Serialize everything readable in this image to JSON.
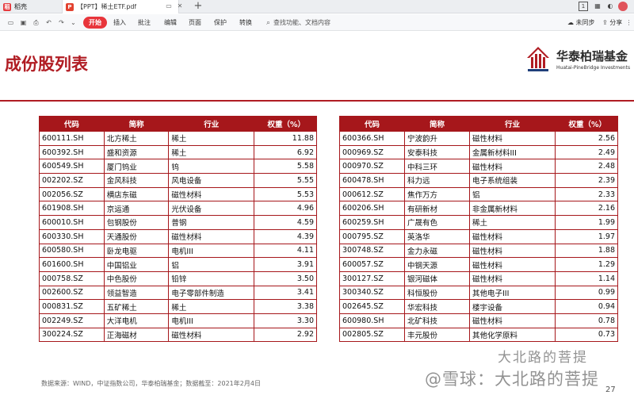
{
  "tabs": {
    "home_label": "稻壳",
    "doc_label": "【PPT】稀土ETF.pdf",
    "doc_logo": "P"
  },
  "toolbar": {
    "menus": [
      "开始",
      "插入",
      "批注",
      "编辑",
      "页面",
      "保护",
      "转换"
    ],
    "search_placeholder": "查找功能、文档内容",
    "unsync": "未同步",
    "share": "分享",
    "window_badge": "1"
  },
  "slide": {
    "title": "成份股列表",
    "logo_cn": "华泰柏瑞基金",
    "logo_en": "Huatai-PineBridge Investments",
    "source": "数据来源：WIND，中证指数公司，华泰柏瑞基金；数据截至：2021年2月4日",
    "page_number": "27",
    "watermark_line1": "大北路的菩提",
    "watermark_line2": "@雪球：大北路的菩提"
  },
  "table_headers": [
    "代码",
    "简称",
    "行业",
    "权重（%）"
  ],
  "left_table": [
    [
      "600111.SH",
      "北方稀土",
      "稀土",
      "11.88"
    ],
    [
      "600392.SH",
      "盛和资源",
      "稀土",
      "6.92"
    ],
    [
      "600549.SH",
      "厦门钨业",
      "钨",
      "5.58"
    ],
    [
      "002202.SZ",
      "金风科技",
      "风电设备",
      "5.55"
    ],
    [
      "002056.SZ",
      "横店东磁",
      "磁性材料",
      "5.53"
    ],
    [
      "601908.SH",
      "京运通",
      "光伏设备",
      "4.96"
    ],
    [
      "600010.SH",
      "包钢股份",
      "普钢",
      "4.59"
    ],
    [
      "600330.SH",
      "天通股份",
      "磁性材料",
      "4.39"
    ],
    [
      "600580.SH",
      "卧龙电驱",
      "电机III",
      "4.11"
    ],
    [
      "601600.SH",
      "中国铝业",
      "铝",
      "3.91"
    ],
    [
      "000758.SZ",
      "中色股份",
      "铅锌",
      "3.50"
    ],
    [
      "002600.SZ",
      "领益智造",
      "电子零部件制造",
      "3.41"
    ],
    [
      "000831.SZ",
      "五矿稀土",
      "稀土",
      "3.38"
    ],
    [
      "002249.SZ",
      "大洋电机",
      "电机III",
      "3.30"
    ],
    [
      "300224.SZ",
      "正海磁材",
      "磁性材料",
      "2.92"
    ]
  ],
  "right_table": [
    [
      "600366.SH",
      "宁波韵升",
      "磁性材料",
      "2.56"
    ],
    [
      "000969.SZ",
      "安泰科技",
      "金属新材料III",
      "2.49"
    ],
    [
      "000970.SZ",
      "中科三环",
      "磁性材料",
      "2.48"
    ],
    [
      "600478.SH",
      "科力远",
      "电子系统组装",
      "2.39"
    ],
    [
      "000612.SZ",
      "焦作万方",
      "铝",
      "2.33"
    ],
    [
      "600206.SH",
      "有研新材",
      "非金属新材料",
      "2.16"
    ],
    [
      "600259.SH",
      "广晟有色",
      "稀土",
      "1.99"
    ],
    [
      "000795.SZ",
      "英洛华",
      "磁性材料",
      "1.97"
    ],
    [
      "300748.SZ",
      "金力永磁",
      "磁性材料",
      "1.88"
    ],
    [
      "600057.SZ",
      "中钢天源",
      "磁性材料",
      "1.29"
    ],
    [
      "300127.SZ",
      "银河磁体",
      "磁性材料",
      "1.14"
    ],
    [
      "300340.SZ",
      "科恒股份",
      "其他电子III",
      "0.99"
    ],
    [
      "002645.SZ",
      "华宏科技",
      "楼宇设备",
      "0.94"
    ],
    [
      "600980.SH",
      "北矿科技",
      "磁性材料",
      "0.78"
    ],
    [
      "002805.SZ",
      "丰元股份",
      "其他化学原料",
      "0.73"
    ]
  ],
  "colors": {
    "accent_red": "#a6171b",
    "title_red": "#b01c23",
    "menu_active": "#e8353b"
  }
}
